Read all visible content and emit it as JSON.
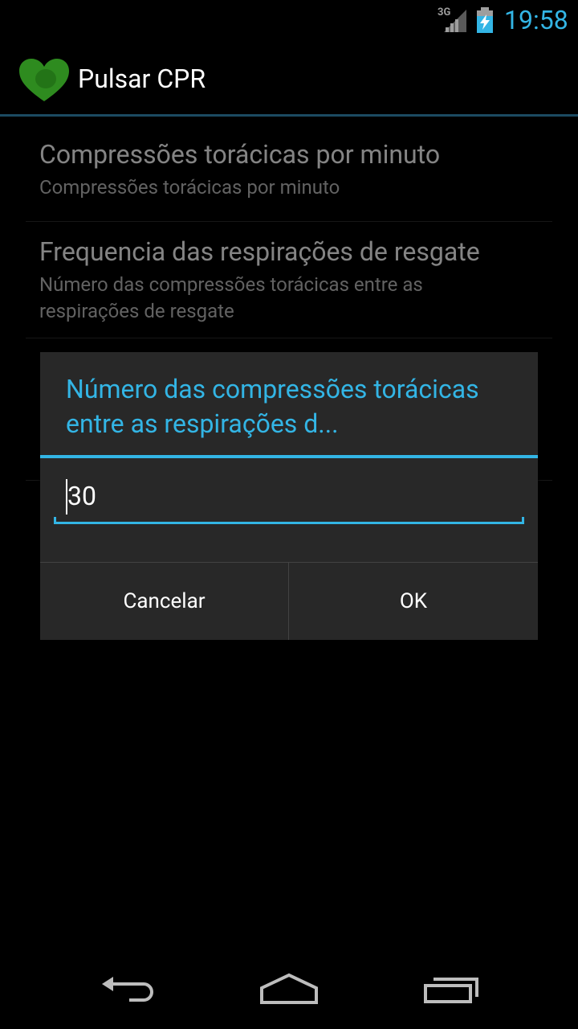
{
  "status": {
    "network": "3G",
    "time": "19:58"
  },
  "app": {
    "title": "Pulsar CPR"
  },
  "preferences": [
    {
      "title": "Compressões torácicas por minuto",
      "summary": "Compressões torácicas por minuto"
    },
    {
      "title": "Frequencia das respirações de resgate",
      "summary": "Número das compressões torácicas entre as respirações de resgate"
    }
  ],
  "dialog": {
    "title": "Número das compressões torácicas entre as respirações d...",
    "value": "30",
    "cancel_label": "Cancelar",
    "ok_label": "OK"
  },
  "colors": {
    "accent": "#33b5e5",
    "logo": "#2e8b1f"
  },
  "icons": {
    "back": "back-icon",
    "home": "home-icon",
    "recents": "recents-icon"
  }
}
